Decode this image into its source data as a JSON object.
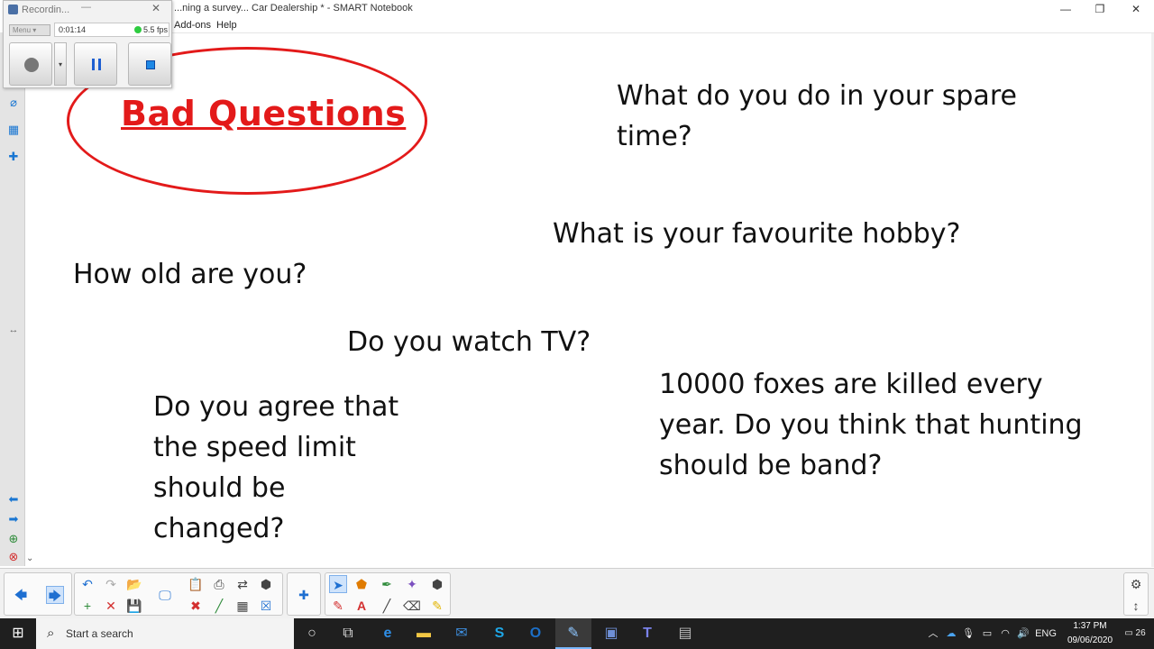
{
  "window": {
    "title": "...ning a survey... Car Dealership * - SMART Notebook",
    "min": "—",
    "max": "❐",
    "close": "✕"
  },
  "menu": {
    "items": [
      "Add-ons",
      "Help"
    ]
  },
  "recorder": {
    "title": "Recordin...",
    "menu_label": "Menu",
    "elapsed": "0:01:14",
    "fps": "5.5 fps",
    "min": "—",
    "close": "✕",
    "dropdown": "▾"
  },
  "canvas": {
    "heading": "Bad Questions",
    "questions": [
      "What do you do in your spare",
      "time?",
      "What is your favourite hobby?",
      "How old are you?",
      "Do you watch TV?",
      "Do you agree that",
      "the speed limit",
      "should be",
      "changed?",
      "10000 foxes are killed every",
      "year. Do you think that hunting",
      "should be band?"
    ],
    "accent": "#e31a1a"
  },
  "sidepanel": {
    "icons": [
      "pages-icon",
      "attachments-icon",
      "gallery-icon",
      "addons-icon",
      "resize-icon",
      "prev-page-arrow-icon",
      "next-page-arrow-icon",
      "add-page-icon",
      "delete-page-icon",
      "panel-collapse-icon"
    ]
  },
  "toolbar": {
    "icons": {
      "prev": "🡄",
      "next": "🡆",
      "undo": "↶",
      "redo": "↷",
      "open": "📂",
      "add_page": "+",
      "delete": "✕",
      "save": "💾",
      "screen": "🖵",
      "paste": "📋",
      "clear": "✖",
      "capture": "⎙",
      "table": "▦",
      "close_x": "☒",
      "share": "⇄",
      "addons": "✚",
      "select": "➤",
      "shapes": "⬟",
      "pen": "✒",
      "eraser": "⌫",
      "text": "A",
      "line": "╱",
      "highlighter": "✎",
      "magic_pen": "✦",
      "fill": "⬢",
      "settings": "⚙",
      "move_toolbar": "↕"
    }
  },
  "taskbar": {
    "start": "⊞",
    "search_placeholder": "Start a search",
    "search_icon": "⌕",
    "cortana": "○",
    "task_view": "⧉",
    "edge": "e",
    "explorer": "▬",
    "mail": "✉",
    "skype": "S",
    "outlook": "O",
    "notebook": "✎",
    "teams_like": "▣",
    "teams": "T",
    "other": "▤",
    "tray_up": "︿",
    "cloud": "☁",
    "mic": "🎙",
    "battery": "▭",
    "wifi": "◠",
    "volume": "🔊",
    "lang": "ENG",
    "time": "1:37 PM",
    "date": "09/06/2020",
    "notifications": "26"
  }
}
